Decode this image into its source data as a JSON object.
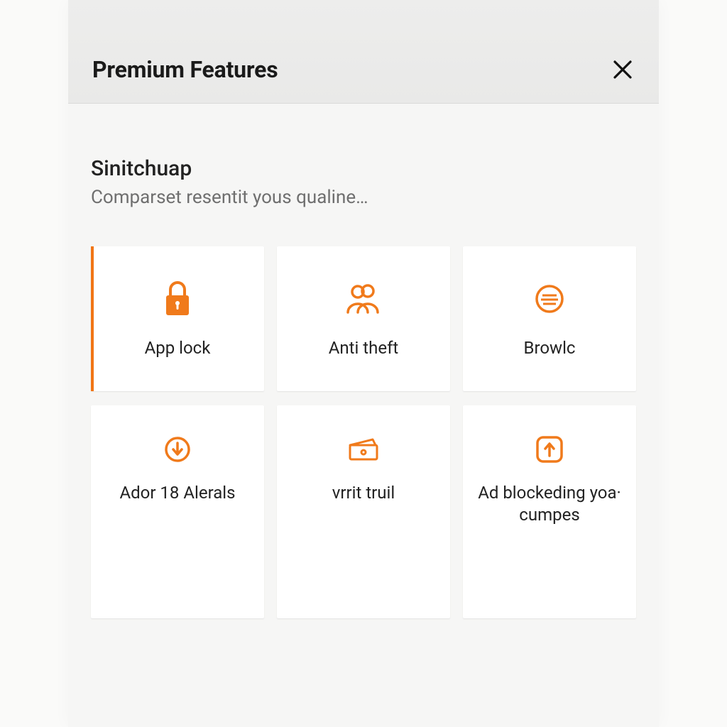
{
  "header": {
    "title": "Premium Features"
  },
  "section": {
    "title": "Sinitchuap",
    "subtitle": "Comparset resentit yous qualine…"
  },
  "cards": [
    {
      "label": "App lock",
      "icon": "lock-icon",
      "selected": true
    },
    {
      "label": "Anti theft",
      "icon": "people-icon",
      "selected": false
    },
    {
      "label": "Browlc",
      "icon": "disc-icon",
      "selected": false
    },
    {
      "label": "Ador 18 Alerals",
      "icon": "download-circle-icon",
      "selected": false
    },
    {
      "label": "vrrit truil",
      "icon": "wallet-icon",
      "selected": false
    },
    {
      "label": "Ad blockeding yoa· cumpes",
      "icon": "upload-box-icon",
      "selected": false
    }
  ],
  "colors": {
    "accent": "#f07a1b"
  }
}
